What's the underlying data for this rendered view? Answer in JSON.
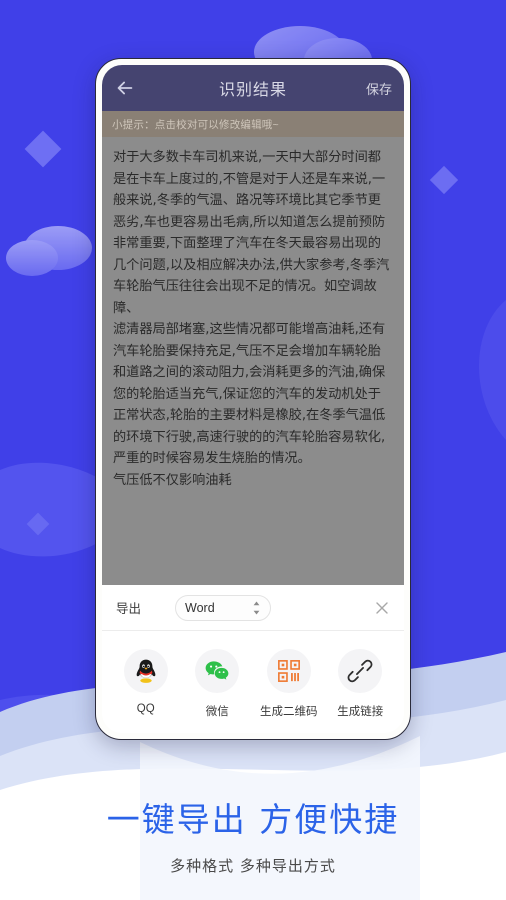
{
  "background": {
    "primary_color": "#4040e8",
    "wave_color": "#5b5bf0",
    "cloud_color": "#8f90f5",
    "diamond_color": "#6f70f2",
    "bottom_color": "#ffffff",
    "bottom_wave_color": "#ccd6f2"
  },
  "phone": {
    "app": {
      "header": {
        "back_icon": "back-arrow-icon",
        "title": "识别结果",
        "save_label": "保存",
        "bar_color": "#454470"
      },
      "tip": {
        "text": "小提示：点击校对可以修改编辑哦~",
        "bar_color": "#8a8075"
      },
      "ocr": {
        "background_color": "#8c8c8c",
        "content": "对于大多数卡车司机来说,一天中大部分时间都是在卡车上度过的,不管是对于人还是车来说,一般来说,冬季的气温、路况等环境比其它季节更恶劣,车也更容易出毛病,所以知道怎么提前预防非常重要,下面整理了汽车在冬天最容易出现的几个问题,以及相应解决办法,供大家参考,冬季汽车轮胎气压往往会出现不足的情况。如空调故障、\n滤清器局部堵塞,这些情况都可能增高油耗,还有汽车轮胎要保持充足,气压不足会增加车辆轮胎和道路之间的滚动阻力,会消耗更多的汽油,确保您的轮胎适当充气,保证您的汽车的发动机处于正常状态,轮胎的主要材料是橡胶,在冬季气温低的环境下行驶,高速行驶的的汽车轮胎容易软化,严重的时候容易发生烧胎的情况。\n气压低不仅影响油耗"
      },
      "export": {
        "label": "导出",
        "format_value": "Word",
        "format_options": [
          "Word"
        ],
        "stepper_icon": "stepper-updown-icon",
        "close_icon": "close-icon"
      },
      "share": {
        "items": [
          {
            "icon": "qq-icon",
            "label": "QQ",
            "color": "#f2c200"
          },
          {
            "icon": "wechat-icon",
            "label": "微信",
            "color": "#2ec04a"
          },
          {
            "icon": "qrcode-icon",
            "label": "生成二维码",
            "color": "#ef7b34"
          },
          {
            "icon": "link-icon",
            "label": "生成链接",
            "color": "#3a3a3a"
          }
        ]
      }
    }
  },
  "footer": {
    "title": "一键导出 方便快捷",
    "subtitle": "多种格式 多种导出方式",
    "title_color": "#2b63e8"
  }
}
